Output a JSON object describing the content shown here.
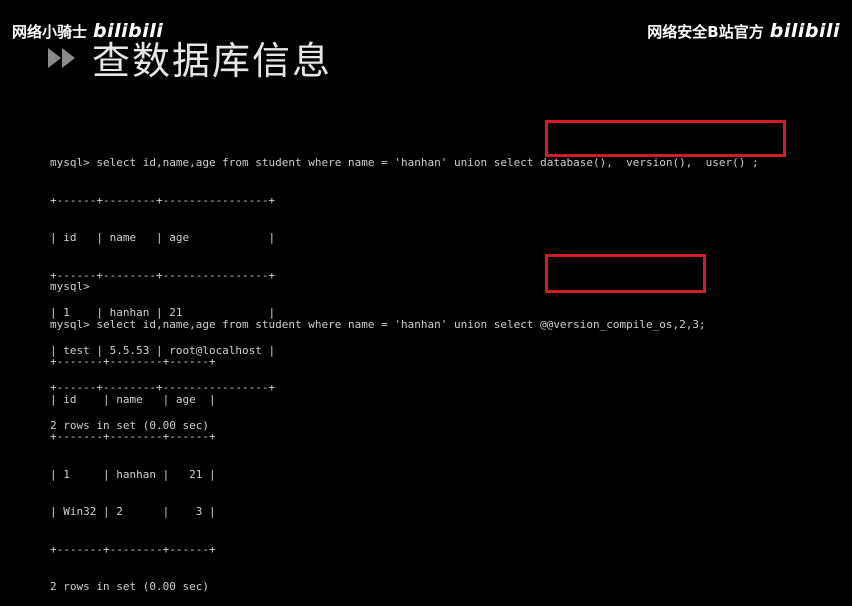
{
  "watermark_left": {
    "text": "网络小骑士",
    "logo": "bilibili"
  },
  "watermark_right": {
    "text": "网络安全B站官方",
    "logo": "bilibili"
  },
  "slide": {
    "title": "查数据库信息"
  },
  "terminal_block_1": {
    "lines": [
      "mysql> select id,name,age from student where name = 'hanhan' union select database(),  version(),  user() ;",
      "+------+--------+----------------+",
      "| id   | name   | age            |",
      "+------+--------+----------------+",
      "| 1    | hanhan | 21             |",
      "| test | 5.5.53 | root@localhost |",
      "+------+--------+----------------+",
      "2 rows in set (0.00 sec)"
    ]
  },
  "terminal_block_2": {
    "lines": [
      "mysql>",
      "mysql> select id,name,age from student where name = 'hanhan' union select @@version_compile_os,2,3;",
      "+-------+--------+------+",
      "| id    | name   | age  |",
      "+-------+--------+------+",
      "| 1     | hanhan |   21 |",
      "| Win32 | 2      |    3 |",
      "+-------+--------+------+",
      "2 rows in set (0.00 sec)"
    ]
  },
  "colors": {
    "background": "#000000",
    "highlight": "#d11a2a",
    "text": "#cfcfcf"
  },
  "icons": {
    "title_bullet": "double-play-icon"
  }
}
